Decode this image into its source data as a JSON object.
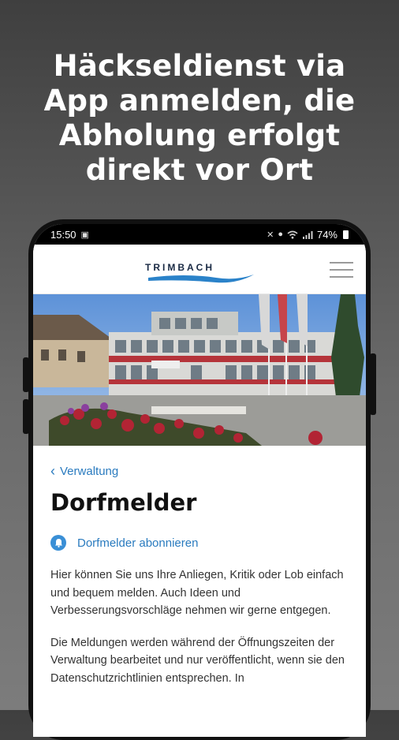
{
  "headline": {
    "line1": "Häckseldienst via",
    "line2": "App anmelden, die",
    "line3": "Abholung erfolgt",
    "line4": "direkt vor Ort"
  },
  "statusbar": {
    "time": "15:50",
    "battery": "74%"
  },
  "app": {
    "logo_text": "TRIMBACH",
    "brand_color": "#2a7bbf"
  },
  "page": {
    "back_label": "Verwaltung",
    "title": "Dorfmelder",
    "subscribe_label": "Dorfmelder abonnieren",
    "paragraph1": "Hier können Sie uns Ihre Anliegen, Kritik oder Lob einfach und bequem melden. Auch Ideen und Verbesserungsvorschläge nehmen wir gerne entgegen.",
    "paragraph2_visible": "Die Meldungen werden während der Öffnungszeiten der Verwaltung bearbeitet und nur veröffentlicht, wenn sie den Datenschutzrichtlinien entsprechen. In"
  },
  "icons": [
    "chevron-left-icon",
    "bell-icon",
    "menu-icon",
    "wifi-icon",
    "signal-icon",
    "location-icon",
    "battery-icon"
  ]
}
